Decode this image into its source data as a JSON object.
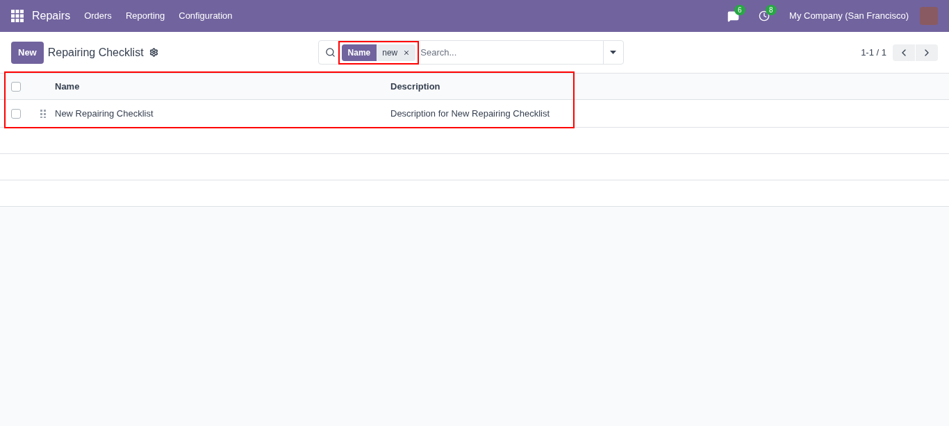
{
  "navbar": {
    "app_name": "Repairs",
    "menu": [
      "Orders",
      "Reporting",
      "Configuration"
    ],
    "messages_count": "6",
    "activities_count": "8",
    "company": "My Company (San Francisco)"
  },
  "control_panel": {
    "new_button": "New",
    "breadcrumb": "Repairing Checklist",
    "search": {
      "facets": [
        {
          "field": "Name",
          "value": "new",
          "highlighted": true
        }
      ],
      "placeholder": "Search..."
    },
    "pager": "1-1 / 1"
  },
  "list": {
    "highlighted": true,
    "select_all_checked": false,
    "columns": [
      "Name",
      "Description"
    ],
    "rows": [
      {
        "checked": false,
        "name": "New Repairing Checklist",
        "description": "Description for New Repairing Checklist"
      }
    ]
  }
}
